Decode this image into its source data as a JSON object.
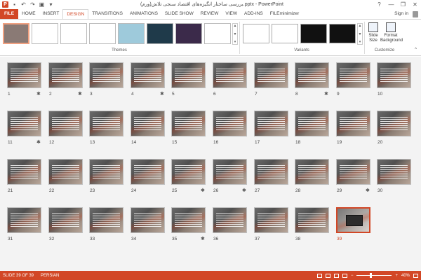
{
  "window": {
    "title": "بررسی ساختار انگیزه‌های اقتصاد سنجی تلاش(ورم).pptx - PowerPoint",
    "app_icon": "P",
    "controls": [
      "?",
      "—",
      "❐",
      "✕"
    ]
  },
  "qat": [
    "save-icon",
    "undo-icon",
    "redo-icon",
    "start-from-beginning-icon",
    "customize-icon"
  ],
  "tabs": [
    "FILE",
    "HOME",
    "INSERT",
    "DESIGN",
    "TRANSITIONS",
    "ANIMATIONS",
    "SLIDE SHOW",
    "REVIEW",
    "VIEW",
    "ADD-INS",
    "FILEminimizer"
  ],
  "active_tab": "DESIGN",
  "signin": "Sign in",
  "ribbon": {
    "themes_label": "Themes",
    "variants_label": "Variants",
    "customize_label": "Customize",
    "slide_size": "Slide Size",
    "format_background": "Format Background",
    "theme_colors": [
      "#8a7a75",
      "#ffffff",
      "#ffffff",
      "#ffffff",
      "#9ecadb",
      "#1f3a4a",
      "#3b2a4a",
      "#ffffff"
    ],
    "variant_colors": [
      "#ffffff",
      "#ffffff",
      "#111111",
      "#111111"
    ]
  },
  "slides": [
    {
      "n": "1",
      "star": true
    },
    {
      "n": "2",
      "star": true
    },
    {
      "n": "3",
      "star": false
    },
    {
      "n": "4",
      "star": true
    },
    {
      "n": "5",
      "star": false
    },
    {
      "n": "6",
      "star": false
    },
    {
      "n": "7",
      "star": false
    },
    {
      "n": "8",
      "star": true
    },
    {
      "n": "9",
      "star": false
    },
    {
      "n": "10",
      "star": false
    },
    {
      "n": "11",
      "star": true
    },
    {
      "n": "12",
      "star": false
    },
    {
      "n": "13",
      "star": false
    },
    {
      "n": "14",
      "star": false
    },
    {
      "n": "15",
      "star": false
    },
    {
      "n": "16",
      "star": false
    },
    {
      "n": "17",
      "star": false
    },
    {
      "n": "18",
      "star": false
    },
    {
      "n": "19",
      "star": false
    },
    {
      "n": "20",
      "star": false
    },
    {
      "n": "21",
      "star": false
    },
    {
      "n": "22",
      "star": false
    },
    {
      "n": "23",
      "star": false
    },
    {
      "n": "24",
      "star": false
    },
    {
      "n": "25",
      "star": true
    },
    {
      "n": "26",
      "star": true
    },
    {
      "n": "27",
      "star": false
    },
    {
      "n": "28",
      "star": false
    },
    {
      "n": "29",
      "star": true
    },
    {
      "n": "30",
      "star": false
    },
    {
      "n": "31",
      "star": false
    },
    {
      "n": "32",
      "star": false
    },
    {
      "n": "33",
      "star": false
    },
    {
      "n": "34",
      "star": false
    },
    {
      "n": "35",
      "star": true
    },
    {
      "n": "36",
      "star": false
    },
    {
      "n": "37",
      "star": false
    },
    {
      "n": "38",
      "star": false
    },
    {
      "n": "39",
      "star": false,
      "selected": true
    }
  ],
  "star_glyph": "✱",
  "status": {
    "slide_info": "SLIDE 39 OF 39",
    "language": "PERSIAN",
    "zoom": "40%",
    "zoom_level": 0.4
  },
  "colors": {
    "accent": "#d24726"
  }
}
